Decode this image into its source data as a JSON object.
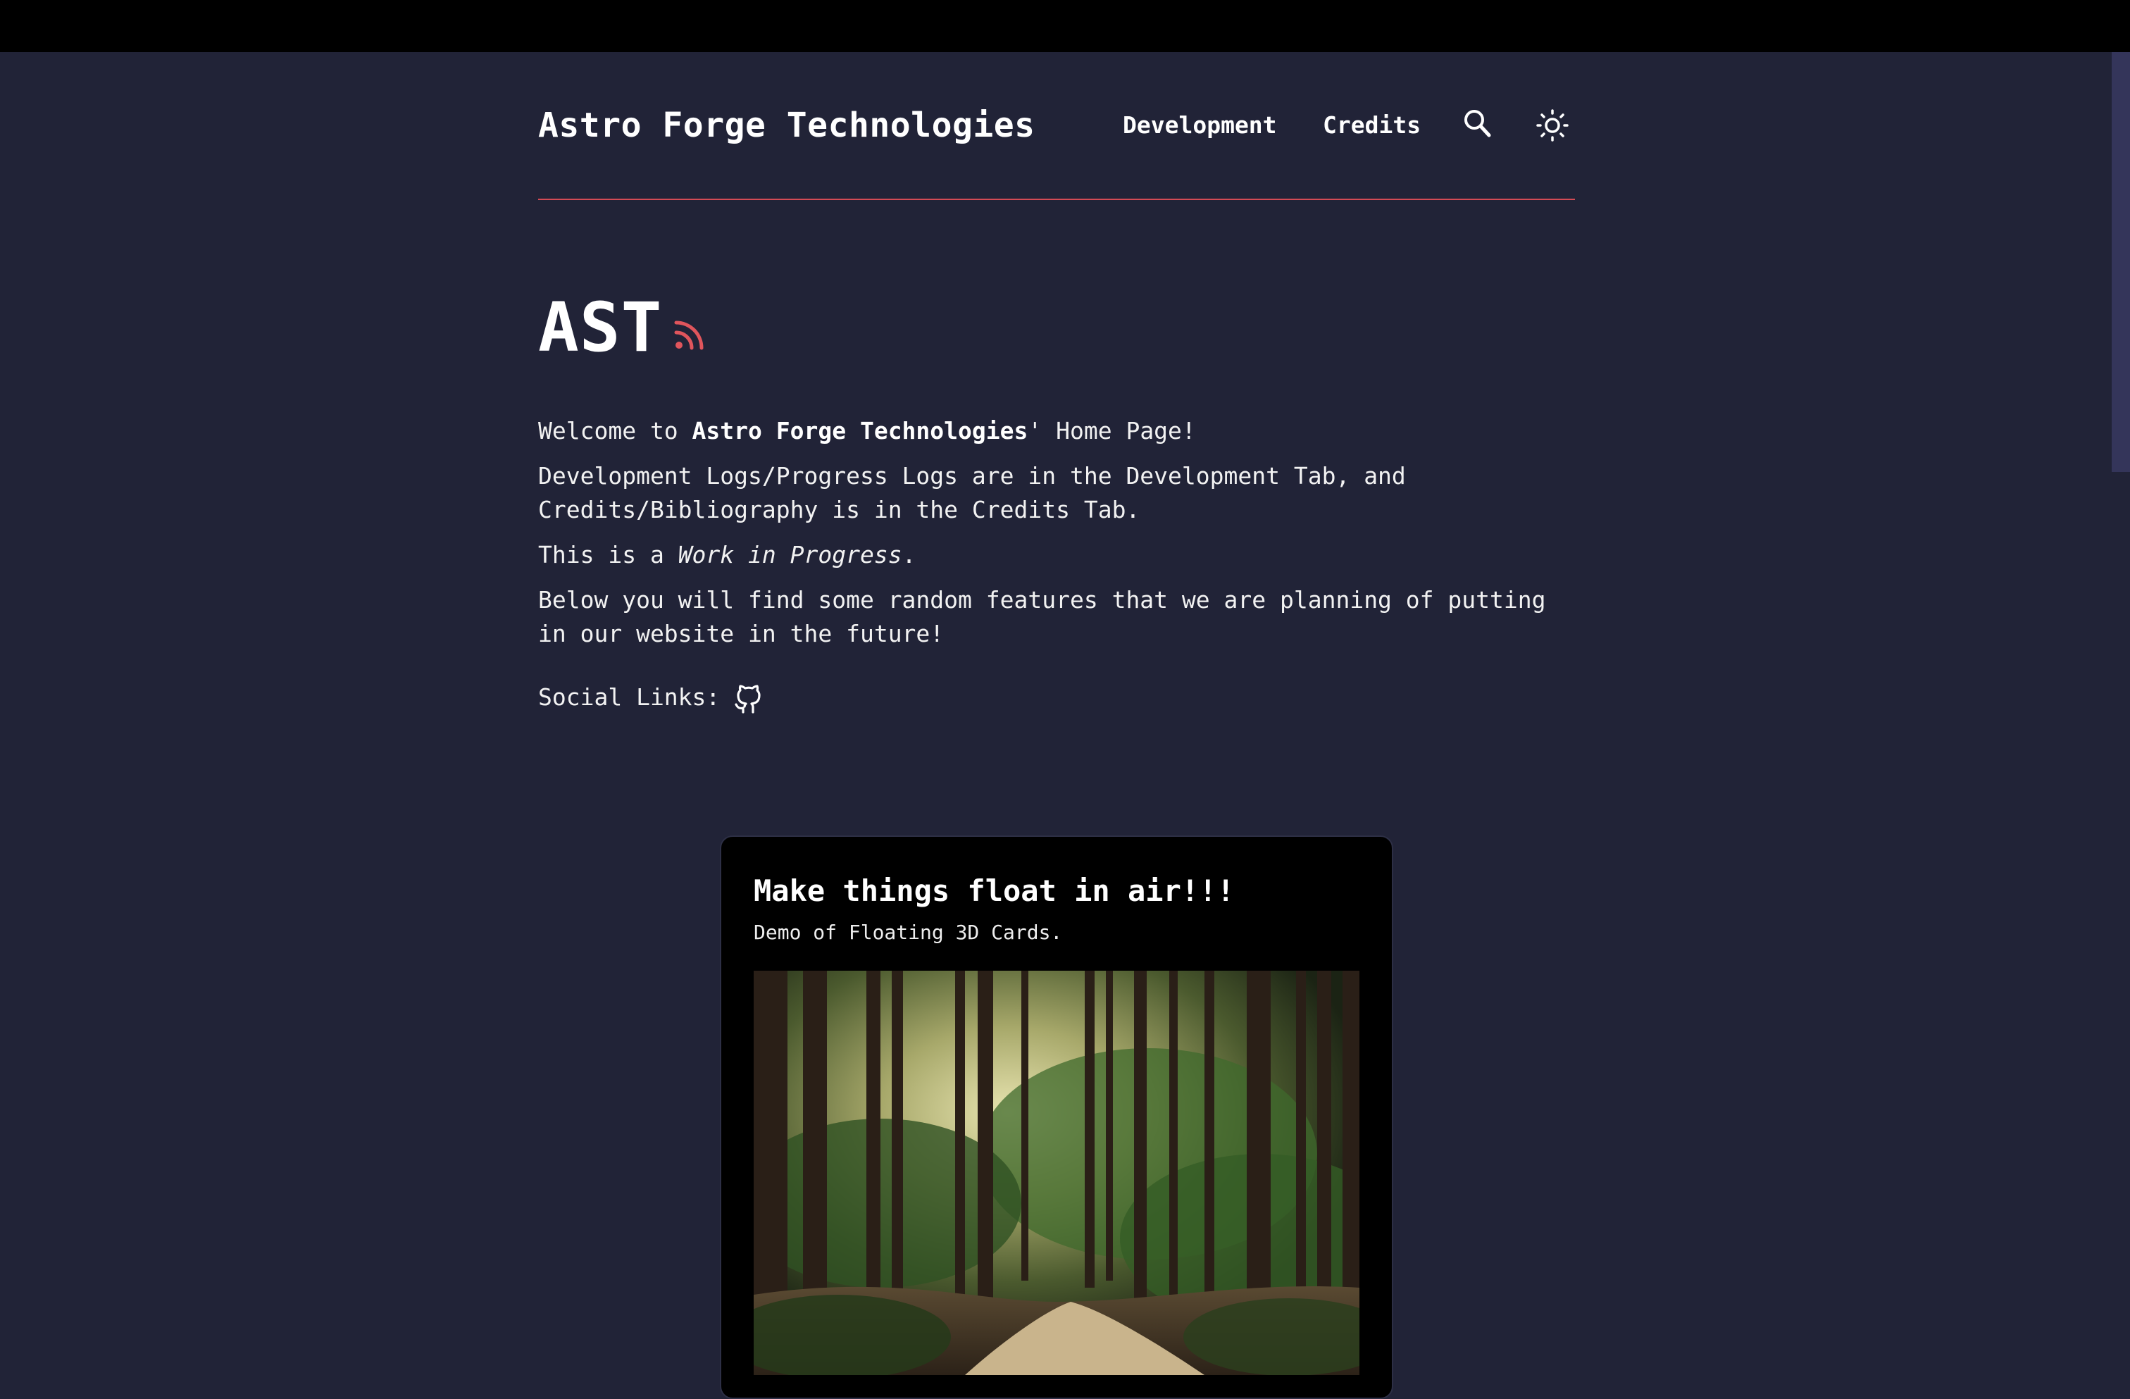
{
  "header": {
    "site_title": "Astro Forge Technologies",
    "nav": [
      {
        "label": "Development"
      },
      {
        "label": "Credits"
      }
    ],
    "search_icon": "search-icon",
    "theme_icon": "sun-icon"
  },
  "hero": {
    "title": "AST",
    "feed_icon": "rss-icon"
  },
  "intro": {
    "p1_prefix": "Welcome to ",
    "p1_bold": "Astro Forge Technologies",
    "p1_suffix": "' Home Page!",
    "p2": "Development Logs/Progress Logs are in the Development Tab, and Credits/Bibliography is in the Credits Tab.",
    "p3_prefix": "This is a ",
    "p3_em": "Work in Progress",
    "p3_suffix": ".",
    "p4": "Below you will find some random features that we are planning of putting in our website in the future!",
    "social_label": "Social Links:",
    "social_icon": "github-icon"
  },
  "card": {
    "title": "Make things float in air!!!",
    "subtitle": "Demo of Floating 3D Cards.",
    "image": "forest-path-image"
  },
  "colors": {
    "background": "#212337",
    "accent": "#d34b55",
    "card_background": "#000000"
  }
}
